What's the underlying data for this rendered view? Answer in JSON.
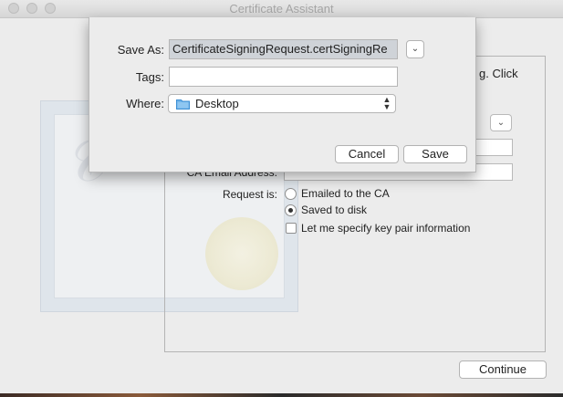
{
  "window": {
    "title": "Certificate Assistant"
  },
  "form": {
    "intro_fragment": "g. Click",
    "ca_email_label": "CA Email Address:",
    "request_label": "Request is:",
    "options": {
      "emailed": "Emailed to the CA",
      "saved": "Saved to disk",
      "keypair": "Let me specify key pair information"
    },
    "selected_option": "saved",
    "continue_label": "Continue"
  },
  "save_sheet": {
    "save_as_label": "Save As:",
    "save_as_value": "CertificateSigningRequest.certSigningRe",
    "tags_label": "Tags:",
    "tags_value": "",
    "where_label": "Where:",
    "where_value": "Desktop",
    "cancel_label": "Cancel",
    "save_label": "Save"
  }
}
